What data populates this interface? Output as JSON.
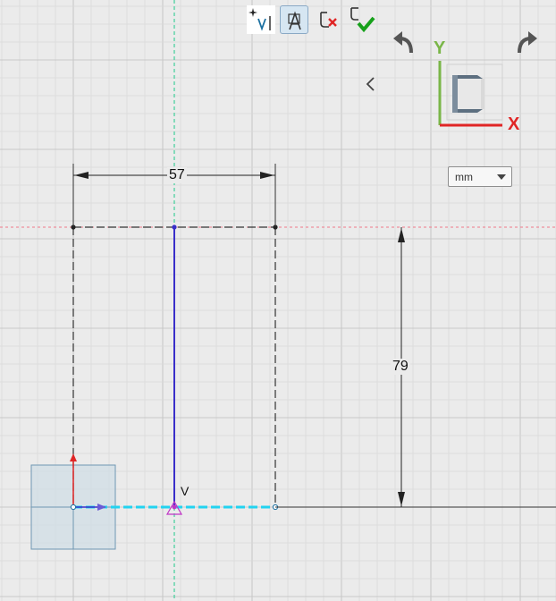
{
  "toolbar": {
    "tools": [
      {
        "name": "insert-vertex-tool",
        "icon": "sparkle-v-cursor-icon",
        "active": false
      },
      {
        "name": "select-tool",
        "icon": "select-arrow-icon",
        "active": true
      },
      {
        "name": "cancel-sketch-tool",
        "icon": "sketch-cancel-icon",
        "active": false
      },
      {
        "name": "finish-sketch-tool",
        "icon": "sketch-accept-icon",
        "active": false
      }
    ],
    "undo_icon": "undo-icon",
    "redo_icon": "redo-icon",
    "collapse_icon": "chevron-left-icon"
  },
  "view_cube": {
    "y_label": "Y",
    "x_label": "X",
    "y_color": "#7ab648",
    "x_color": "#e02626"
  },
  "units": {
    "selected": "mm"
  },
  "sketch": {
    "width_dimension": "57",
    "height_dimension": "79",
    "vertex_label": "V"
  },
  "colors": {
    "background": "#ebebeb",
    "grid_minor": "#d9d9d9",
    "grid_major": "#c8c8c8",
    "axis_y_guide": "#3fcf9a",
    "axis_x_guide": "#ef7a8a",
    "construction_line": "#333333",
    "selected_line": "#3a2fc9",
    "highlight_line": "#22d3f0",
    "origin_box": "#a9c4d6"
  }
}
